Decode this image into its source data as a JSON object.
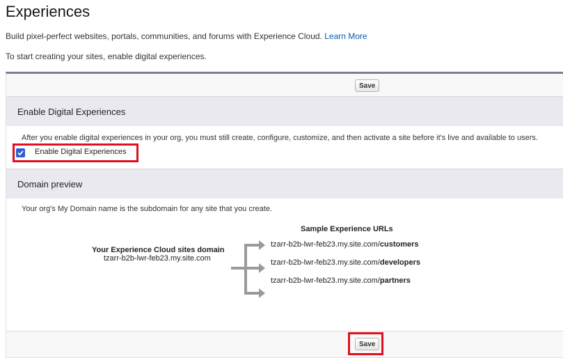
{
  "page": {
    "title": "Experiences",
    "intro": "Build pixel-perfect websites, portals, communities, and forums with Experience Cloud.",
    "learn_more": "Learn More",
    "start_hint": "To start creating your sites, enable digital experiences."
  },
  "toolbar": {
    "save_label": "Save"
  },
  "enable_section": {
    "heading": "Enable Digital Experiences",
    "help_text": "After you enable digital experiences in your org, you must still create, configure, customize, and then activate a site before it's live and available to users.",
    "checkbox_label": "Enable Digital Experiences",
    "checked": true
  },
  "domain_section": {
    "heading": "Domain preview",
    "help_text": "Your org's My Domain name is the subdomain for any site that you create.",
    "domain_title": "Your Experience Cloud sites domain",
    "domain_value": "tzarr-b2b-lwr-feb23.my.site.com",
    "sample_title": "Sample Experience URLs",
    "urls": [
      {
        "prefix": "tzarr-b2b-lwr-feb23.my.site.com/",
        "path": "customers"
      },
      {
        "prefix": "tzarr-b2b-lwr-feb23.my.site.com/",
        "path": "developers"
      },
      {
        "prefix": "tzarr-b2b-lwr-feb23.my.site.com/",
        "path": "partners"
      }
    ]
  },
  "footer": {
    "save_label": "Save"
  },
  "colors": {
    "highlight": "#e0101c",
    "checkbox": "#2f5fd0",
    "link": "#0b5cab"
  }
}
